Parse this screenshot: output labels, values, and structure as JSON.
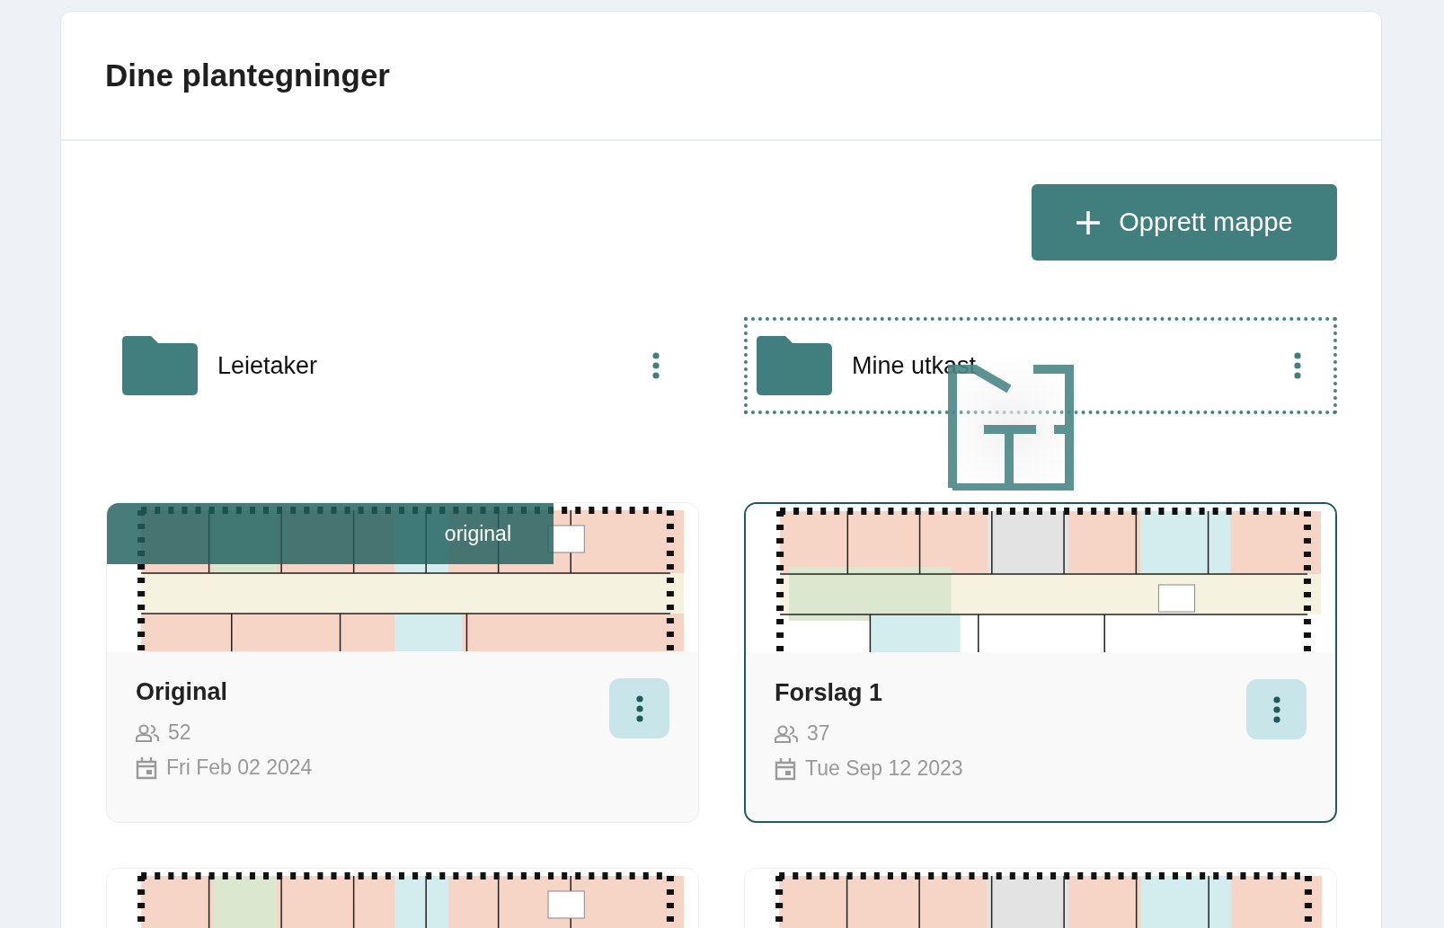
{
  "page": {
    "title": "Dine plantegninger"
  },
  "create_folder_button": {
    "label": "Opprett mappe"
  },
  "folders": [
    {
      "name": "Leietaker",
      "drop_target": false
    },
    {
      "name": "Mine utkast",
      "drop_target": true
    }
  ],
  "plans": [
    {
      "thumbnail": {
        "kind": "picture"
      },
      "name": "Original",
      "people": "52",
      "date": "Fri Feb 02 2024",
      "selected": false,
      "dragging": true,
      "drag_label": "original"
    },
    {
      "thumbnail": {
        "kind": "picture"
      },
      "name": "Forslag 1",
      "people": "37",
      "date": "Tue Sep 12 2023",
      "selected": true,
      "dragging": false
    },
    {
      "thumbnail": {
        "kind": "picture"
      }
    },
    {
      "thumbnail": {
        "kind": "picture"
      }
    }
  ]
}
